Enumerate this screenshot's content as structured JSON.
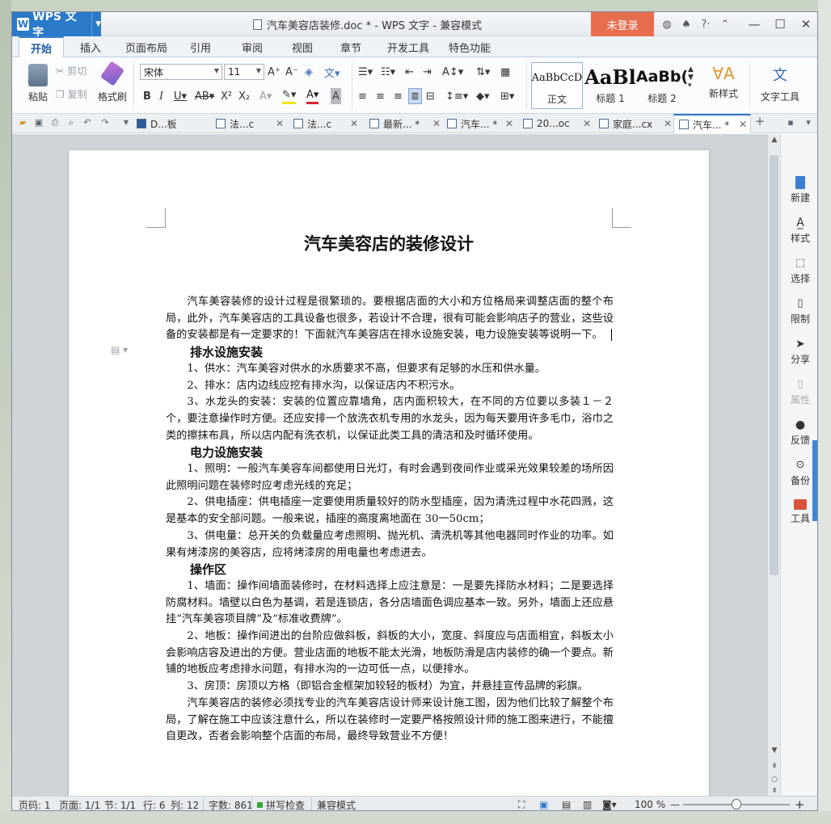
{
  "app": {
    "name": "WPS 文字",
    "window_title": "汽车美容店装修.doc * - WPS 文字 - 兼容模式",
    "login": "未登录"
  },
  "menu_tabs": [
    "开始",
    "插入",
    "页面布局",
    "引用",
    "审阅",
    "视图",
    "章节",
    "开发工具",
    "特色功能"
  ],
  "ribbon": {
    "paste": "粘贴",
    "cut": "剪切",
    "copy": "复制",
    "format_painter": "格式刷",
    "font_name": "宋体",
    "font_size": "11",
    "styles": [
      {
        "sample": "AaBbCcD",
        "label": "正文"
      },
      {
        "sample": "AaBl",
        "label": "标题 1"
      },
      {
        "sample": "AaBb(",
        "label": "标题 2"
      }
    ],
    "new_style": "新样式",
    "text_tools": "文字工具"
  },
  "doc_tabs": [
    "D...板",
    "法...c",
    "法...c",
    "最新... *",
    "汽车... *",
    "20...oc",
    "家庭...cx",
    "汽车... *"
  ],
  "document": {
    "title": "汽车美容店的装修设计",
    "blocks": [
      {
        "t": "p",
        "text": "汽车美容装修的设计过程是很繁琐的。要根据店面的大小和方位格局来调整店面的整个布局，此外，汽车美容店的工具设备也很多，若设计不合理，很有可能会影响店子的营业，这些设备的安装都是有一定要求的！下面就汽车美容店在排水设施安装，电力设施安装等说明一下。"
      },
      {
        "t": "h",
        "text": "排水设施安装"
      },
      {
        "t": "p",
        "text": "1、供水：汽车美容对供水的水质要求不高，但要求有足够的水压和供水量。"
      },
      {
        "t": "p",
        "text": "2、排水：店内边线应挖有排水沟，以保证店内不积污水。"
      },
      {
        "t": "p",
        "text": "3、水龙头的安装：安装的位置应靠墙角，店内面积较大，在不同的方位要以多装１－２个，要注意操作时方便。还应安排一个放洗衣机专用的水龙头，因为每天要用许多毛巾，浴巾之类的擦抹布具，所以店内配有洗衣机，以保证此类工具的清洁和及时循环使用。"
      },
      {
        "t": "h",
        "text": "电力设施安装"
      },
      {
        "t": "p",
        "text": "1、照明：一般汽车美容车间都使用日光灯，有时会遇到夜间作业或采光效果较差的场所因此照明问题在装修时应考虑光线的充足；"
      },
      {
        "t": "p",
        "text": "2、供电插座：供电插座一定要使用质量较好的防水型插座，因为清洗过程中水花四溅，这是基本的安全部问题。一般来说，插座的高度离地面在 30一50cm；"
      },
      {
        "t": "p",
        "text": "3、供电量：总开关的负载量应考虑照明、抛光机、清洗机等其他电器同时作业的功率。如果有烤漆房的美容店，应将烤漆房的用电量也考虑进去。"
      },
      {
        "t": "h",
        "text": "操作区"
      },
      {
        "t": "p",
        "text": "1、墙面：操作间墙面装修时，在材料选择上应注意是：一是要先择防水材料；二是要选择防腐材料。墙壁以白色为基调，若是连锁店，各分店墙面色调应基本一致。另外，墙面上还应悬挂“汽车美容项目牌”及“标准收费牌”。"
      },
      {
        "t": "p",
        "text": "2、地板：操作间进出的台阶应做斜板，斜板的大小，宽度、斜度应与店面相宜，斜板太小会影响店容及进出的方便。营业店面的地板不能太光滑，地板防滑是店内装修的确一个要点。新铺的地板应考虑排水问题，有排水沟的一边可低一点，以便排水。"
      },
      {
        "t": "p",
        "text": "3、房顶：房顶以方格（即铝合金框架加较轻的板材）为宜，并悬挂宣传品牌的彩旗。"
      },
      {
        "t": "p",
        "text": "汽车美容店的装修必须找专业的汽车美容店设计师来设计施工图，因为他们比较了解整个布局，了解在施工中应该注意什么，所以在装修时一定要严格按照设计师的施工图来进行，不能擅自更改，否者会影响整个店面的布局，最终导致营业不方便！"
      }
    ]
  },
  "sidebar": [
    "新建",
    "样式",
    "选择",
    "限制",
    "分享",
    "属性",
    "反馈",
    "备份",
    "工具"
  ],
  "status": {
    "page_no": "页码: 1",
    "pages": "页面: 1/1",
    "section": "节: 1/1",
    "row": "行: 6",
    "col": "列: 12",
    "words": "字数: 861",
    "spell": "拼写检查",
    "mode": "兼容模式",
    "zoom": "100 %"
  },
  "colors": {
    "accent": "#2b79c9",
    "login": "#e86d4e",
    "ribbon_bg": "#fbfcfd"
  }
}
